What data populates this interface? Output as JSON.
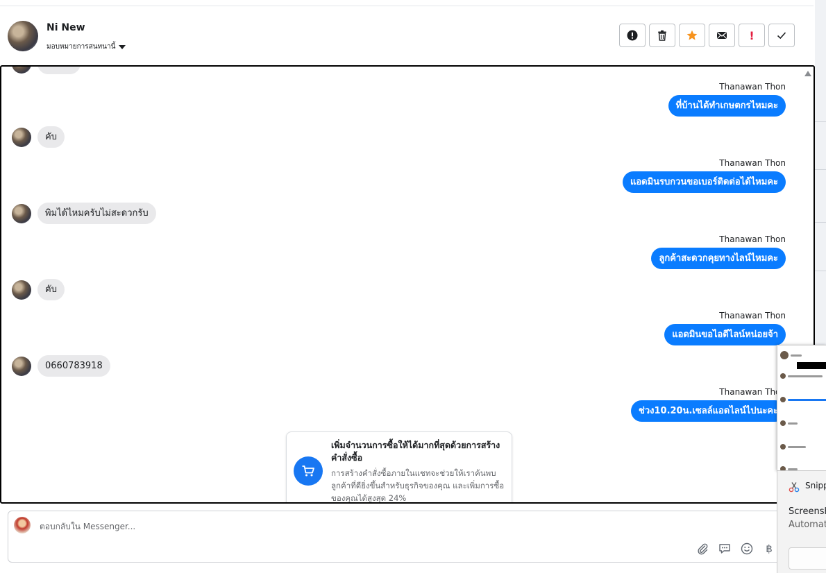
{
  "header": {
    "contact_name": "Ni New",
    "assign_label": "มอบหมายการสนทนานี้",
    "toolbar": [
      {
        "name": "alert-button",
        "icon": "alert-circle-icon"
      },
      {
        "name": "delete-button",
        "icon": "trash-icon"
      },
      {
        "name": "star-button",
        "icon": "star-icon"
      },
      {
        "name": "mail-button",
        "icon": "envelope-icon"
      },
      {
        "name": "important-button",
        "icon": "exclamation-icon",
        "glyph": "!"
      },
      {
        "name": "done-button",
        "icon": "check-icon"
      }
    ]
  },
  "messages": {
    "outgoing_sender": "Thanawan Thon",
    "items": [
      {
        "type": "out",
        "sender": "Thanawan Thon",
        "text": "ที่บ้านได้ทำเกษตกรไหมคะ"
      },
      {
        "type": "in",
        "text": "คับ"
      },
      {
        "type": "out",
        "sender": "Thanawan Thon",
        "text": "แอดมินรบกวนขอเบอร์ติดต่อได้ไหมคะ"
      },
      {
        "type": "in",
        "text": "พิมได้ไหมครับไม่สะดวกรับ"
      },
      {
        "type": "out",
        "sender": "Thanawan Thon",
        "text": "ลูกค้าสะดวกคุยทางไลน์ไหมคะ"
      },
      {
        "type": "in",
        "text": "คับ"
      },
      {
        "type": "out",
        "sender": "Thanawan Thon",
        "text": "แอดมินขอไอดีไลน์หน่อยจ้า"
      },
      {
        "type": "in",
        "text": "0660783918"
      },
      {
        "type": "out",
        "sender": "Thanawan Thon",
        "text": "ช่วง10.20น.เซลล์แอดไลน์ไปนะคะ"
      }
    ]
  },
  "promo": {
    "title": "เพิ่มจำนวนการซื้อให้ได้มากที่สุดด้วยการสร้างคำสั่งซื้อ",
    "body": "การสร้างคำสั่งซื้อภายในแชทจะช่วยให้เราค้นพบลูกค้าที่ดียิ่งขึ้นสำหรับธุรกิจของคุณ และเพิ่มการซื้อของคุณได้สูงสุด 24%",
    "icon": "shopping-cart-icon"
  },
  "composer": {
    "placeholder": "ตอบกลับใน Messenger...",
    "tools": [
      "paperclip-icon",
      "saved-reply-icon",
      "emoji-icon",
      "baht-icon"
    ],
    "baht_glyph": "฿"
  },
  "snipping": {
    "app_name": "Snipping Tool",
    "line1": "Screenshot copied to clipboard",
    "line2": "Automatically saved to screenshots folder"
  },
  "colors": {
    "accent": "#0a7cff",
    "star": "#f7931e",
    "important": "#e41e3f"
  }
}
